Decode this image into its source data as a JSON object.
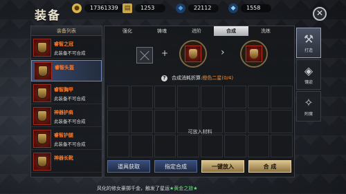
{
  "title": "装备",
  "resources": [
    {
      "icon": "coin-icon",
      "value": "17361339",
      "color": "#d8b44a",
      "glyph": "●"
    },
    {
      "icon": "scroll-icon",
      "value": "1253",
      "color": "#c9a64a",
      "glyph": "▤"
    },
    {
      "icon": "crystal-icon",
      "value": "22112",
      "color": "#4fa3e6",
      "glyph": "◆"
    },
    {
      "icon": "diamond-icon",
      "value": "1558",
      "color": "#8fd0ff",
      "glyph": "◆"
    }
  ],
  "left_panel": {
    "header": "装备列表",
    "items": [
      {
        "name": "睿智之冠",
        "sub": "此装备不可合成",
        "selected": false
      },
      {
        "name": "睿智头盔",
        "sub": "",
        "selected": true
      },
      {
        "name": "睿智胸甲",
        "sub": "此装备不可合成",
        "selected": false
      },
      {
        "name": "神器护肩",
        "sub": "此装备不可合成",
        "selected": false
      },
      {
        "name": "睿智护腿",
        "sub": "此装备不可合成",
        "selected": false
      },
      {
        "name": "神器长靴",
        "sub": "",
        "selected": false
      }
    ]
  },
  "tabs": [
    "强化",
    "铸魂",
    "进阶",
    "合成",
    "洗练"
  ],
  "active_tab": "合成",
  "cost": {
    "label": "合成消耗折算:",
    "value": "橙色二星(0/4)"
  },
  "grid_message": "可放入材料",
  "buttons": {
    "obtain": "道具获取",
    "designate": "指定合成",
    "auto_fill": "一键放入",
    "compose": "合 成"
  },
  "right_tabs": [
    {
      "label": "打造",
      "icon": "anvil-icon",
      "glyph": "⚒"
    },
    {
      "label": "镶嵌",
      "icon": "gem-icon",
      "glyph": "◈"
    },
    {
      "label": "附魔",
      "icon": "enchant-icon",
      "glyph": "✧"
    }
  ],
  "ticker": {
    "text": "风化的修女豪掷千金，触发了星运",
    "highlight": "★黄金之旅★"
  }
}
